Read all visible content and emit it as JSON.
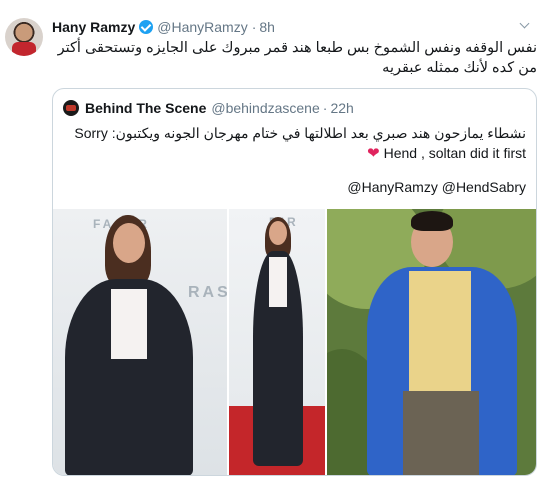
{
  "tweet": {
    "name": "Hany Ramzy",
    "handle": "@HanyRamzy",
    "separator": "·",
    "time": "8h",
    "text": "نفس الوقفه ونفس الشموخ بس طبعا هند قمر مبروك على الجايزه وتستحقى أكتر من كده لأنك ممثله عبقريه"
  },
  "quoted": {
    "name": "Behind The Scene",
    "handle": "@behindzascene",
    "separator": "·",
    "time": "22h",
    "text_ar": "نشطاء يمازحون هند صبري بعد اطلالتها في ختام مهرجان الجونه ويكتبون: Sorry",
    "text_en": "Hend , soltan did it first",
    "mentions": "@HanyRamzy @HendSabry"
  },
  "icons": [
    "verified-badge-icon",
    "chevron-down-icon",
    "heart-icon"
  ],
  "colors": {
    "verified": "#1da1f2",
    "muted": "#657786",
    "heart": "#e0245e",
    "border": "#ccd6dd"
  }
}
